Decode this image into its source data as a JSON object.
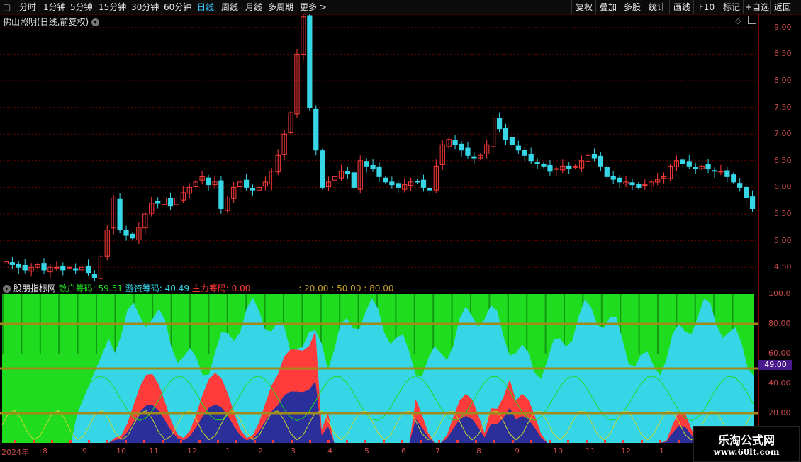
{
  "periods": [
    "分时",
    "1分钟",
    "5分钟",
    "15分钟",
    "30分钟",
    "60分钟",
    "日线",
    "周线",
    "月线",
    "多周期",
    "更多 >"
  ],
  "active_period": "日线",
  "right_buttons": [
    "复权",
    "叠加",
    "多股",
    "统计",
    "画线",
    "F10",
    "标记",
    "+自选",
    "返回"
  ],
  "stock_title": "佛山照明(日线,前复权)",
  "price_axis": [
    "9.00",
    "8.50",
    "8.00",
    "7.50",
    "7.00",
    "6.50",
    "6.00",
    "5.50",
    "5.00",
    "4.50"
  ],
  "indicator": {
    "name": "股朋指标网",
    "retail_label": "散户筹码:",
    "retail_value": "59.51",
    "hot_label": "游资筹码:",
    "hot_value": "40.49",
    "main_label": "主力筹码:",
    "main_value": "0.00",
    "levels_label": ": 20.00 : 50.00 : 80.00"
  },
  "ind_axis": [
    "100.0",
    "80.00",
    "60.00",
    "40.00",
    "20.00"
  ],
  "highlight_value": "49.00",
  "date_axis": [
    "2024年",
    "8",
    "9",
    "10",
    "11",
    "12",
    "1",
    "2",
    "3",
    "4",
    "5",
    "6",
    "7",
    "8",
    "9",
    "10",
    "11",
    "12",
    "1"
  ],
  "watermark": {
    "title": "乐淘公式网",
    "url": "www.60lt.com"
  },
  "colors": {
    "up": "#ff3b3b",
    "down": "#36d6e7",
    "green": "#1fdc1f",
    "grid": "#6b0000",
    "level": "#a08a1a"
  },
  "chart_data": {
    "type": "candlestick",
    "title": "佛山照明(日线,前复权)",
    "ylim": [
      4.25,
      9.25
    ],
    "close_series": [
      4.6,
      4.55,
      4.5,
      4.45,
      4.5,
      4.55,
      4.45,
      4.5,
      4.5,
      4.45,
      4.5,
      4.45,
      4.5,
      4.4,
      4.3,
      4.7,
      5.2,
      5.8,
      5.2,
      5.1,
      5.05,
      5.25,
      5.5,
      5.7,
      5.7,
      5.8,
      5.65,
      5.8,
      5.9,
      6.0,
      6.1,
      6.2,
      6.05,
      6.1,
      5.6,
      5.8,
      6.0,
      6.1,
      6.0,
      5.95,
      6.0,
      6.1,
      6.3,
      6.6,
      7.0,
      7.4,
      8.5,
      9.2,
      7.5,
      6.7,
      6.0,
      6.1,
      6.2,
      6.3,
      6.25,
      6.0,
      6.5,
      6.4,
      6.35,
      6.2,
      6.1,
      6.05,
      6.0,
      6.05,
      6.1,
      6.1,
      6.0,
      5.95,
      6.4,
      6.8,
      6.9,
      6.8,
      6.7,
      6.6,
      6.55,
      6.6,
      6.8,
      7.3,
      7.1,
      6.9,
      6.8,
      6.7,
      6.6,
      6.5,
      6.45,
      6.4,
      6.3,
      6.35,
      6.4,
      6.35,
      6.4,
      6.5,
      6.6,
      6.55,
      6.4,
      6.2,
      6.15,
      6.1,
      6.1,
      6.05,
      6.0,
      6.05,
      6.1,
      6.15,
      6.2,
      6.4,
      6.5,
      6.45,
      6.4,
      6.35,
      6.4,
      6.35,
      6.3,
      6.3,
      6.2,
      6.1,
      6.0,
      5.8,
      5.6
    ]
  }
}
